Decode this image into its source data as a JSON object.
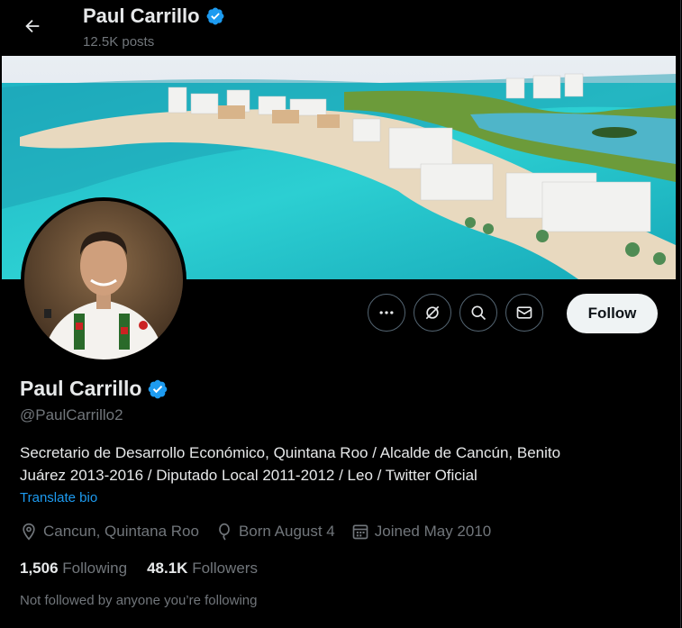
{
  "header": {
    "name": "Paul Carrillo",
    "posts": "12.5K posts"
  },
  "actions": {
    "follow_label": "Follow"
  },
  "profile": {
    "name": "Paul Carrillo",
    "handle": "@PaulCarrillo2",
    "bio_line1": "Secretario de Desarrollo Económico, Quintana Roo / Alcalde de Cancún, Benito",
    "bio_line2": "Juárez 2013-2016 / Diputado Local 2011-2012 / Leo / Twitter Oficial",
    "translate": "Translate bio",
    "location": "Cancun, Quintana Roo",
    "born": "Born August 4",
    "joined": "Joined May 2010",
    "following_count": "1,506",
    "following_label": "Following",
    "followers_count": "48.1K",
    "followers_label": "Followers",
    "not_followed": "Not followed by anyone you’re following"
  },
  "colors": {
    "accent": "#1d9bf0",
    "muted": "#71767b",
    "text": "#e7e9ea",
    "background": "#000000"
  },
  "icons": [
    "back-arrow-icon",
    "verified-badge-icon",
    "more-icon",
    "grok-icon",
    "search-icon",
    "mail-icon",
    "location-icon",
    "balloon-icon",
    "calendar-icon"
  ]
}
